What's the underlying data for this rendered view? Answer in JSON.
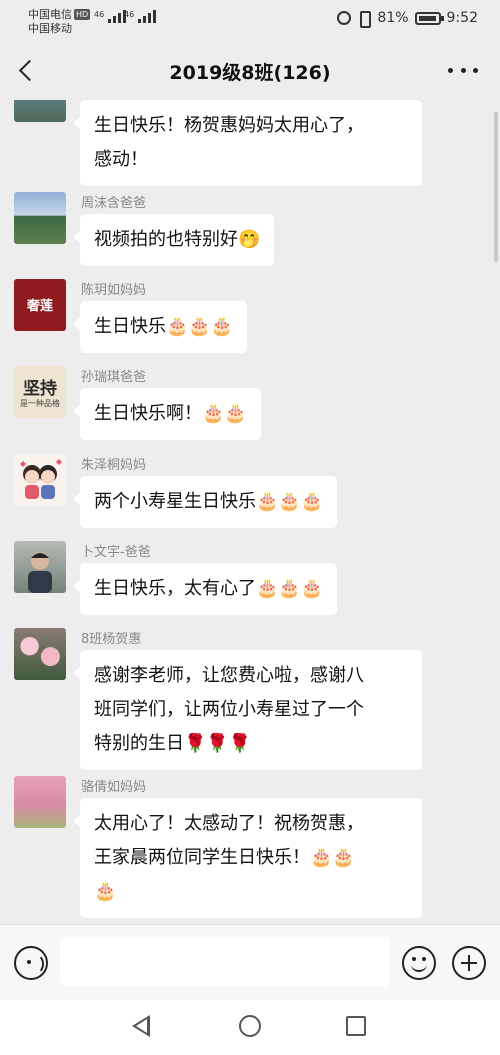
{
  "status_bar": {
    "carrier_1": "中国电信",
    "carrier_1_badge": "HD",
    "carrier_2": "中国移动",
    "signal_label_1": "46",
    "signal_label_2": "46",
    "battery": "81%",
    "time": "9:52"
  },
  "header": {
    "title": "2019级8班(126)"
  },
  "messages": [
    {
      "sender": "",
      "lines": [
        "生日快乐！杨贺惠妈妈太用心了，",
        "感动！"
      ],
      "avatar": "photo"
    },
    {
      "sender": "周沫含爸爸",
      "lines": [
        "视频拍的也特别好🤭"
      ],
      "avatar": "lake-photo"
    },
    {
      "sender": "陈玥如妈妈",
      "lines": [
        "生日快乐🎂🎂🎂"
      ],
      "avatar": "red-logo",
      "avatar_text": "奢莲"
    },
    {
      "sender": "孙瑞琪爸爸",
      "lines": [
        "生日快乐啊！🎂🎂"
      ],
      "avatar": "text-logo",
      "avatar_text": "坚持",
      "avatar_subtext": "是一种品格"
    },
    {
      "sender": "朱泽桐妈妈",
      "lines": [
        "两个小寿星生日快乐🎂🎂🎂"
      ],
      "avatar": "cartoon-couple"
    },
    {
      "sender": "卜文宇-爸爸",
      "lines": [
        "生日快乐，太有心了🎂🎂🎂"
      ],
      "avatar": "man-photo"
    },
    {
      "sender": "8班杨贺惠",
      "lines": [
        "感谢李老师，让您费心啦，感谢八",
        "班同学们，让两位小寿星过了一个",
        "特别的生日🌹🌹🌹"
      ],
      "avatar": "flowers-photo"
    },
    {
      "sender": "骆倩如妈妈",
      "lines": [
        "太用心了！太感动了！祝杨贺惠，",
        "王家晨两位同学生日快乐！🎂🎂",
        "🎂"
      ],
      "avatar": "pink-trees-photo"
    }
  ],
  "input_bar": {
    "placeholder": "",
    "voice_icon": "voice-icon",
    "emoji_icon": "emoji-icon",
    "plus_icon": "plus-icon"
  },
  "nav_bar": {
    "back_icon": "nav-back-icon",
    "home_icon": "nav-home-icon",
    "recents_icon": "nav-recents-icon"
  }
}
